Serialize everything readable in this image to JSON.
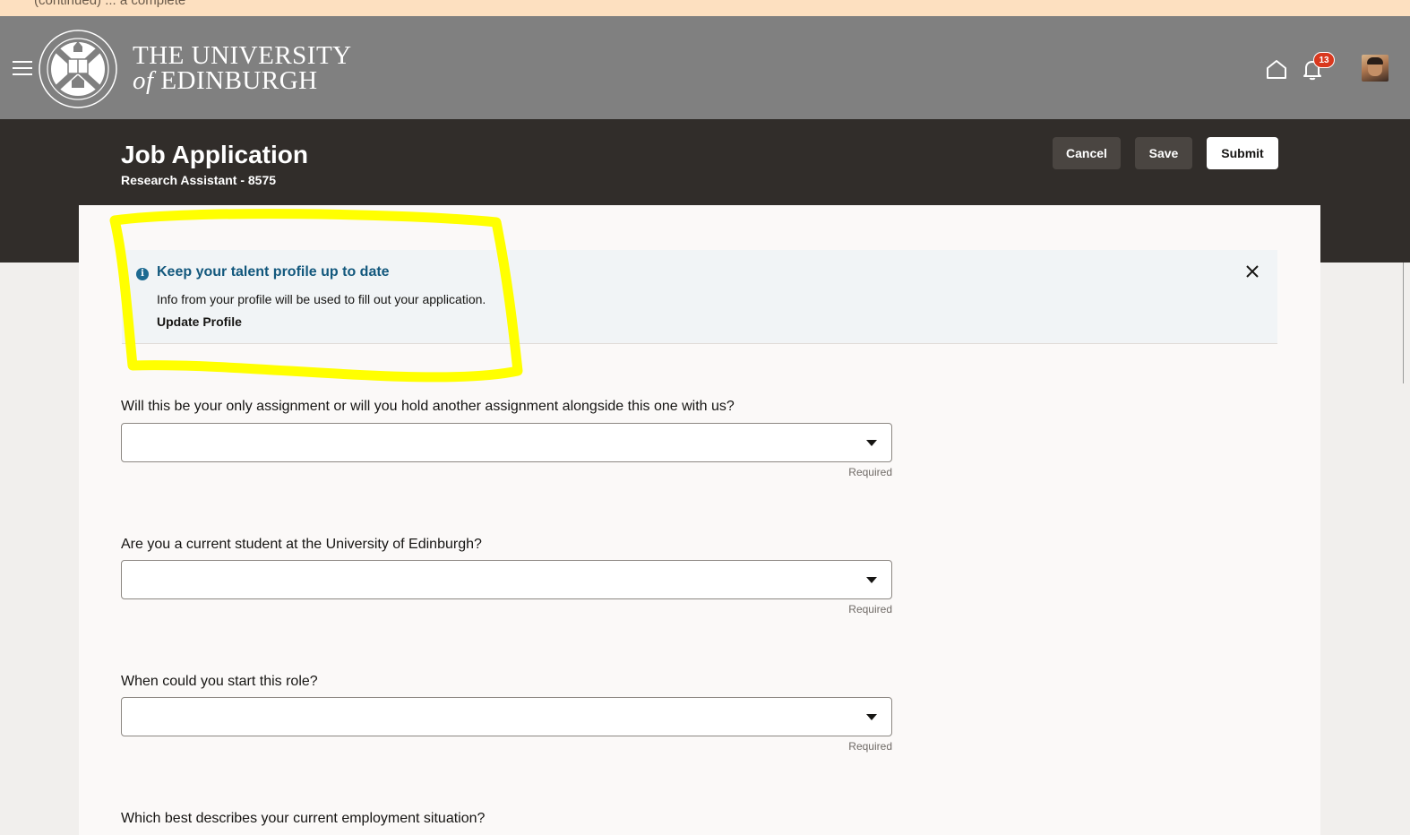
{
  "top_strip": {
    "text": "(continued) ... a complete"
  },
  "university": {
    "name_line1": "THE UNIVERSITY",
    "name_of": "of",
    "name_line2": "EDINBURGH"
  },
  "header_icons": {
    "menu": "hamburger-menu-icon",
    "home": "home-icon",
    "notifications": "bell-icon",
    "notification_count": "13"
  },
  "page": {
    "title": "Job Application",
    "subtitle": "Research Assistant - 8575"
  },
  "actions": {
    "cancel_label": "Cancel",
    "save_label": "Save",
    "submit_label": "Submit"
  },
  "info_banner": {
    "title": "Keep your talent profile up to date",
    "text": "Info from your profile will be used to fill out your application.",
    "link": "Update Profile"
  },
  "questions": [
    {
      "label": "Will this be your only assignment or will you hold another assignment alongside this one with us?",
      "value": "",
      "hint": "Required"
    },
    {
      "label": "Are you a current student at the University of Edinburgh?",
      "value": "",
      "hint": "Required"
    },
    {
      "label": "When could you start this role?",
      "value": "",
      "hint": "Required"
    },
    {
      "label": "Which best describes your current employment situation?",
      "value": "",
      "hint": ""
    }
  ],
  "colors": {
    "university_bar": "#808080",
    "app_header": "#312d2a",
    "info_title": "#13587d",
    "highlight": "#ffff00",
    "badge": "#d9381e"
  }
}
